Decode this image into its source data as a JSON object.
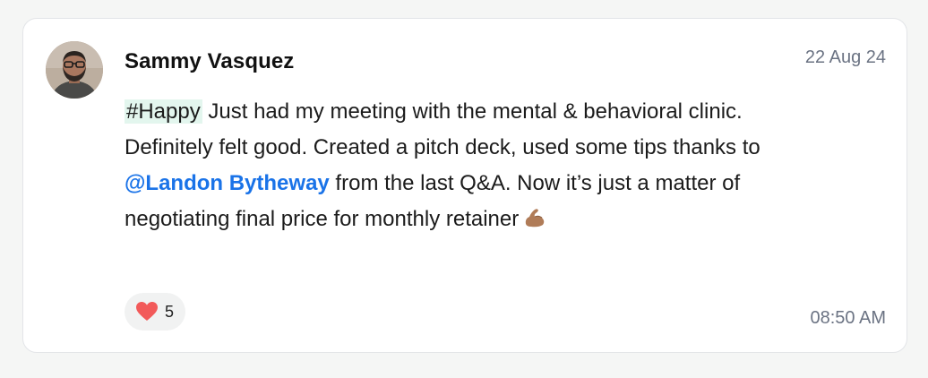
{
  "post": {
    "author": "Sammy Vasquez",
    "date": "22 Aug 24",
    "hashtag": "#Happy",
    "text_1": " Just had my meeting with the mental & behavioral clinic. Definitely felt good. Created a pitch deck, used some tips thanks to ",
    "mention": "@Landon Bytheway",
    "text_2": " from the last Q&A. Now it’s just a matter of negotiating final price for monthly retainer",
    "emoji": "flexed-biceps-icon",
    "reaction": {
      "icon": "heart-icon",
      "count": "5"
    },
    "time": "08:50 AM"
  },
  "colors": {
    "mention": "#1a73e8",
    "hashtag_bg": "#e3f6ee",
    "heart": "#f25a5a",
    "muted_text": "#6b7383"
  }
}
